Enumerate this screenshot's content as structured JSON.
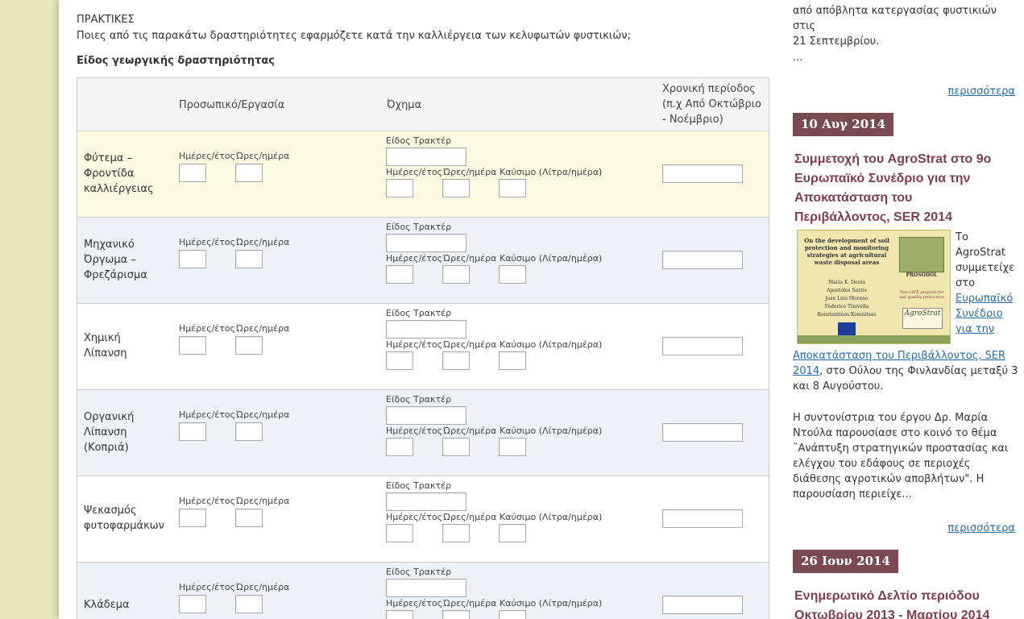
{
  "main": {
    "section_title": "ΠΡΑΚΤΙΚΕΣ",
    "question": "Ποιες από τις παρακάτω δραστηριότητες εφαρμόζετε κατά την καλλιέργεια των κελυφωτών φυστικιών;",
    "subheading": "Είδος γεωργικής δραστηριότητας",
    "table": {
      "headers": {
        "personal": "Προσωπικό/Εργασία",
        "vehicle": "Όχημα",
        "period_line1": "Χρονική περίοδος",
        "period_line2": "(π.χ Από Οκτώβριο",
        "period_line3": "- Νοέμβριο)"
      },
      "field_labels": {
        "days_year": "Ημέρες/έτος",
        "hours_day": "Ώρες/ημέρα",
        "tractor_type": "Είδος Τρακτέρ",
        "fuel": "Καύσιμο (Λίτρα/ημέρα)"
      },
      "rows": [
        {
          "line1": "Φύτεμα –",
          "line2": "Φροντίδα",
          "line3": "καλλιέργειας"
        },
        {
          "line1": "Μηχανικό",
          "line2": "Όργωμα –",
          "line3": "Φρεζάρισμα"
        },
        {
          "line1": "Χημική",
          "line2": "Λίπανση",
          "line3": ""
        },
        {
          "line1": "Οργανική",
          "line2": "Λίπανση",
          "line3": "(Κοπριά)"
        },
        {
          "line1": "Ψεκασμός",
          "line2": "φυτοφαρμάκων",
          "line3": ""
        },
        {
          "line1": "Κλάδεμα",
          "line2": "",
          "line3": ""
        }
      ]
    }
  },
  "sidebar": {
    "prev_snippet_line1": "από απόβλητα κατεργασίας φυστικιών στις",
    "prev_snippet_line2": "21 Σεπτεμβρίου.",
    "ellipsis": "...",
    "more_label": "περισσότερα",
    "news": [
      {
        "date": "10 Αυγ 2014",
        "title_line1": "Συμμετοχή του AgroStrat στο 9ο",
        "title_line2": "Ευρωπαϊκό Συνέδριο για την",
        "title_line3": "Αποκατάσταση του",
        "title_line4": "Περιβάλλοντος, SER 2014",
        "body_side1": "Το",
        "body_side2": "AgroStrat",
        "body_side3": "συμμετείχε",
        "body_side4": "στο",
        "link_side1": "Ευρωπαϊκό",
        "link_side2": "Συνέδριο",
        "link_side3": "για την",
        "link_full1": "Αποκατάσταση του Περιβάλλοντος, SER",
        "link_full2": "2014",
        "body_after_link": ", στο Ούλου της Φινλανδίας μεταξύ 3",
        "body_line2": "και 8 Αυγούστου.",
        "para2_l1": "Η συντονίστρια του έργου Δρ. Μαρία",
        "para2_l2": "Ντούλα παρουσίασε στο κοινό το θέμα",
        "para2_l3": "¨Ανάπτυξη στρατηγικών προστασίας και",
        "para2_l4": "ελέγχου του εδάφους σε περιοχές",
        "para2_l5": "διάθεσης αγροτικών αποβλήτων\". Η",
        "para2_l6": "παρουσίαση περιείχε...",
        "image": {
          "title": "On the development of soil protection and monitoring strategies at agricultural waste disposal areas",
          "names": [
            "Maria K. Doula",
            "Apostolos Sarris",
            "Jose Luis Moreno",
            "Federico Tinivella",
            "Konstantinos Komnitsas"
          ],
          "project": "PROSODOL",
          "project_sub": "Two LIFE projects for soil quality protection",
          "logo": "AgroStrat"
        }
      },
      {
        "date": "26 Ιουν 2014",
        "title_line1": "Ενημερωτικό Δελτίο περιόδου",
        "title_line2": "Οκτωβρίου 2013 - Μαρτίου 2014"
      }
    ]
  }
}
